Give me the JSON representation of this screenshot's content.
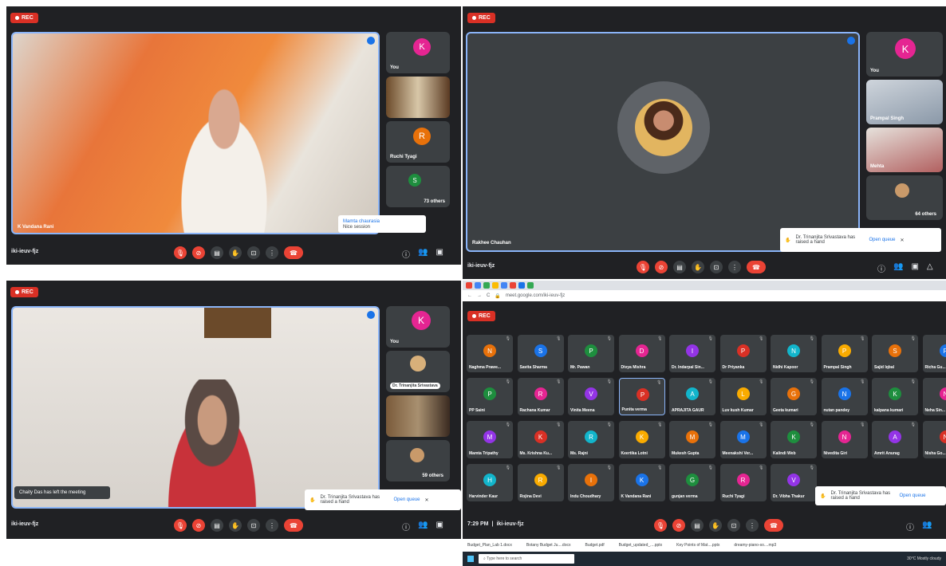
{
  "p1": {
    "rec": "REC",
    "main_name": "K Vandana Rani",
    "side": [
      {
        "name": "You",
        "letter": "K",
        "color": "#e52592"
      },
      {
        "name": ""
      },
      {
        "name": "Ruchi Tyagi",
        "letter": "R",
        "color": "#e8710a"
      },
      {
        "name": "73 others",
        "letter": "S",
        "color": "#1e8e3e"
      }
    ],
    "code": "iki-ieuv-fjz",
    "toast_name": "Mamta chaurasia",
    "toast_msg": "Nice session",
    "badge": "77"
  },
  "p2": {
    "rec": "REC",
    "main_name": "Rakhee Chauhan",
    "side": [
      {
        "name": "You",
        "letter": "K",
        "color": "#e52592"
      },
      {
        "name": "Prampal Singh"
      },
      {
        "name": "Mehta"
      },
      {
        "name": "64 others"
      }
    ],
    "code": "iki-ieuv-fjz",
    "toast": "Dr. Trinanjita Srivastava has raised a hand",
    "open": "Open queue",
    "badge": "68"
  },
  "p3": {
    "rec": "REC",
    "side": [
      {
        "name": "You",
        "letter": "K",
        "color": "#e52592"
      },
      {
        "name": "Dr. Trinanjita Srivastava"
      },
      {
        "name": ""
      },
      {
        "name": "59 others"
      }
    ],
    "left_msg": "Chaity Das has left the meeting",
    "code": "iki-ieuv-fjz",
    "toast": "Dr. Trinanjita Srivastava has raised a hand",
    "open": "Open queue",
    "badge": "63"
  },
  "p4": {
    "url": "meet.google.com/iki-ieuv-fjz",
    "rec": "REC",
    "time": "7:29 PM",
    "code": "iki-ieuv-fjz",
    "toast": "Dr. Trinanjita Srivastava has raised a hand",
    "open": "Open queue",
    "badge": "70",
    "grid": [
      [
        "Naghma Prawe...",
        "Savita Sharma",
        "Mr. Pawan",
        "Divya Mishra",
        "Dr. Indarpal Sin...",
        "Dr Priyanka",
        "Nidhi Kapoor",
        "Prampal Singh",
        "Sajid Iqbal",
        "Richa Gu..."
      ],
      [
        "PP Saini",
        "Rachana Kumar",
        "Vinita Meena",
        "Punita verma",
        "APRAJITA GAUR",
        "Luv kush Kumar",
        "Geeta kumari",
        "nutan pandey",
        "kalpana kumari",
        "Neha Sin..."
      ],
      [
        "Mamta Tripathy",
        "Ms. Krishna Ku...",
        "Ms. Rajni",
        "Keertika Lotni",
        "Mukesh Gupta",
        "Meenakshi Ver...",
        "Kalindi Web",
        "Nivedita Giri",
        "Amrit Anurag",
        "Nisha Go..."
      ],
      [
        "Harvinder Kaur",
        "Rojina Devi",
        "Indu Choudhary",
        "K Vandana Rani",
        "gunjan verma",
        "Ruchi Tyagi",
        "Dr. Vibha Thakur",
        "",
        ""
      ]
    ],
    "downloads": [
      "Budget_Plan_Lab 1.docx",
      "Botany Budget Ju....docx",
      "Budget.pdf",
      "Budget_updated_....pptx",
      "Key Points of Mat....pptx",
      "dreamy-piano-so....mp3"
    ],
    "search": "Type here to search",
    "weather": "30°C Mostly cloudy"
  }
}
